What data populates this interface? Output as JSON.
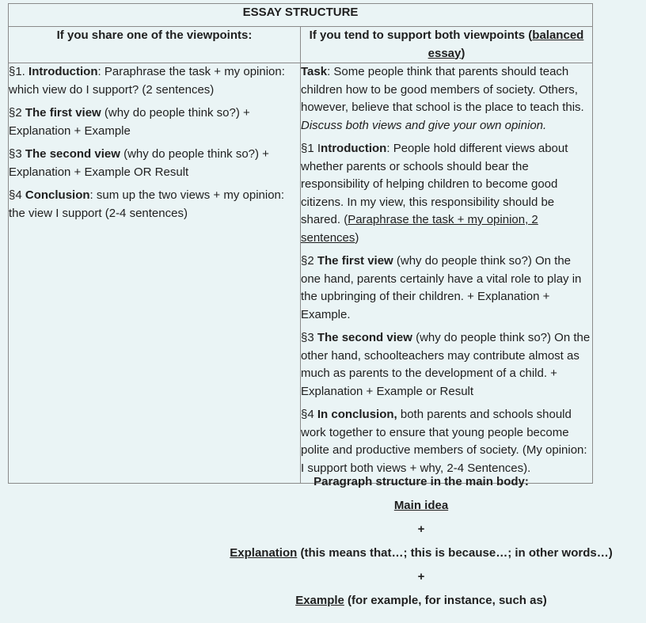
{
  "table": {
    "title": "ESSAY STRUCTURE",
    "left_heading": "If you share one of the viewpoints:",
    "right_heading_prefix": "If you tend to support both viewpoints (",
    "right_heading_link": "balanced essay",
    "right_heading_suffix": ")",
    "left": {
      "p1_num": "§1. ",
      "p1_bold": "Introduction",
      "p1_text": ": Paraphrase the task + my opinion: which view do I support? (2 sentences)",
      "p2_num": "§2 ",
      "p2_bold": "The first view",
      "p2_text": " (why do people think so?) + Explanation + Example",
      "p3_num": "§3 ",
      "p3_bold": "The second view",
      "p3_text": " (why do people think so?) + Explanation + Example OR Result",
      "p4_num": "§4 ",
      "p4_bold": "Conclusion",
      "p4_text": ": sum up the two views + my opinion: the view I support (2-4 sentences)"
    },
    "right": {
      "task_bold": "Task",
      "task_text": ": Some people think that parents should teach children how to be good members of society. Others, however, believe that school is the place to teach this. ",
      "task_italic": "Discuss both views and give your own opinion.",
      "p1_num": "§1 I",
      "p1_bold": "ntroduction",
      "p1_text": ": People hold different views about whether parents or schools should bear the responsibility of helping children to become good citizens. In my view, this responsibility should be shared. (",
      "p1_link": "Paraphrase the task + my opinion, 2 sentences",
      "p1_end": ")",
      "p2_num": "§2 ",
      "p2_bold": "The first view",
      "p2_text": " (why do people think so?) On the one hand, parents certainly have a vital role to play in the upbringing of their children. + Explanation + Example.",
      "p3_num": "§3 ",
      "p3_bold": "The second view",
      "p3_text": " (why do people think so?) On the other hand, schoolteachers may contribute almost as much as parents to the development of a child. + Explanation + Example or Result",
      "p4_num": "§4 ",
      "p4_bold": "In conclusion,",
      "p4_text": " both parents and schools should work together to ensure that young people become polite and productive members of society. (My opinion: I support both views + why, 2-4 Sentences)."
    }
  },
  "paragraph": {
    "heading": "Paragraph structure in the main body:",
    "main_idea": "Main idea",
    "plus1": "+",
    "explanation_link": "Explanation",
    "explanation_text": " (this means that…; this is because…; in other words…)",
    "plus2": "+",
    "example_link": "Example",
    "example_text": " (for example, for instance, such as)"
  }
}
